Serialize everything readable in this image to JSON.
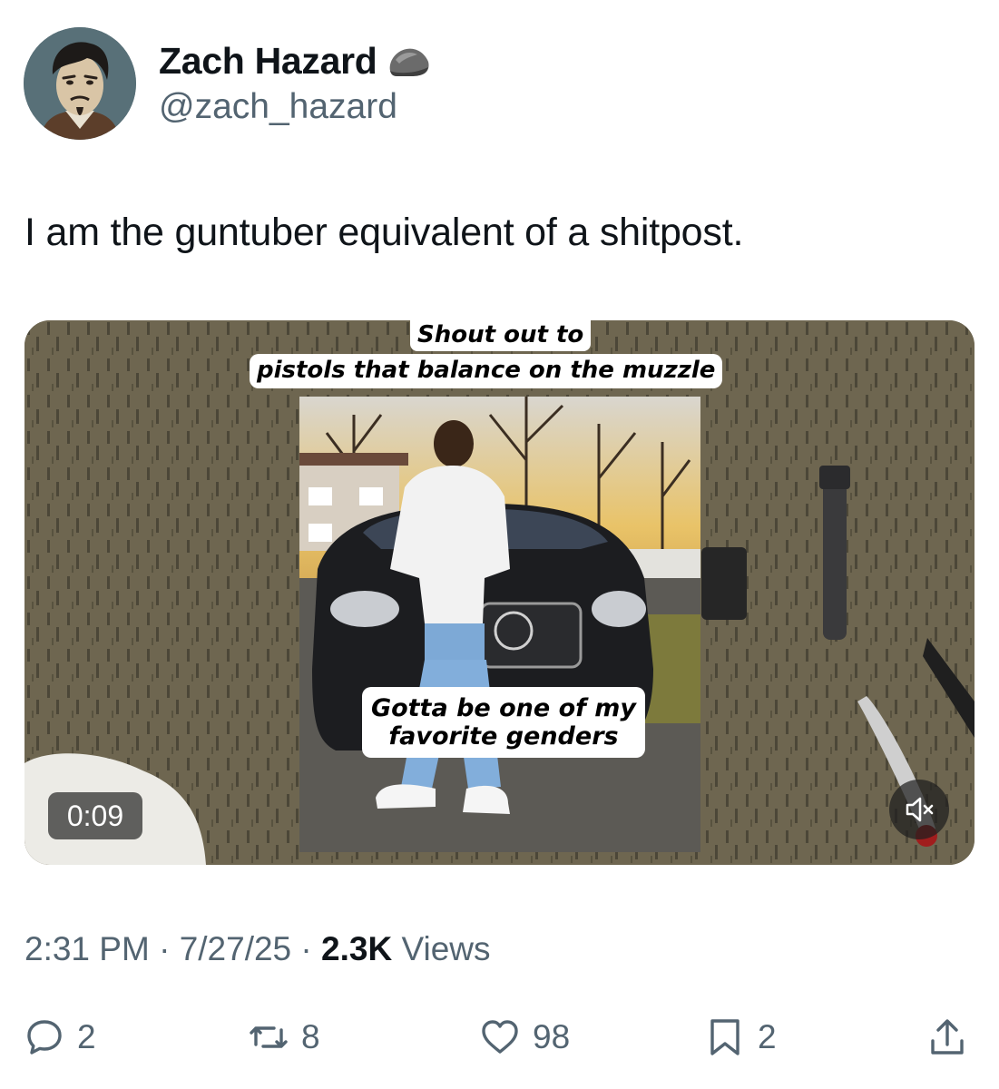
{
  "author": {
    "display_name": "Zach Hazard",
    "handle": "@zach_hazard",
    "badge_icon": "rock-icon"
  },
  "tweet": {
    "text": "I am the guntuber equivalent of a shitpost."
  },
  "media": {
    "caption_top_line1": "Shout out to",
    "caption_top_line2": "pistols that balance on the muzzle",
    "caption_bottom": "Gotta be one of my favorite genders",
    "duration": "0:09",
    "mute_icon": "volume-muted-icon"
  },
  "meta": {
    "time": "2:31 PM",
    "separator": "·",
    "date": "7/27/25",
    "views_count": "2.3K",
    "views_label": "Views"
  },
  "actions": {
    "replies": "2",
    "reposts": "8",
    "likes": "98",
    "bookmarks": "2"
  },
  "colors": {
    "text_primary": "#0f1419",
    "text_secondary": "#536471",
    "background": "#ffffff"
  }
}
